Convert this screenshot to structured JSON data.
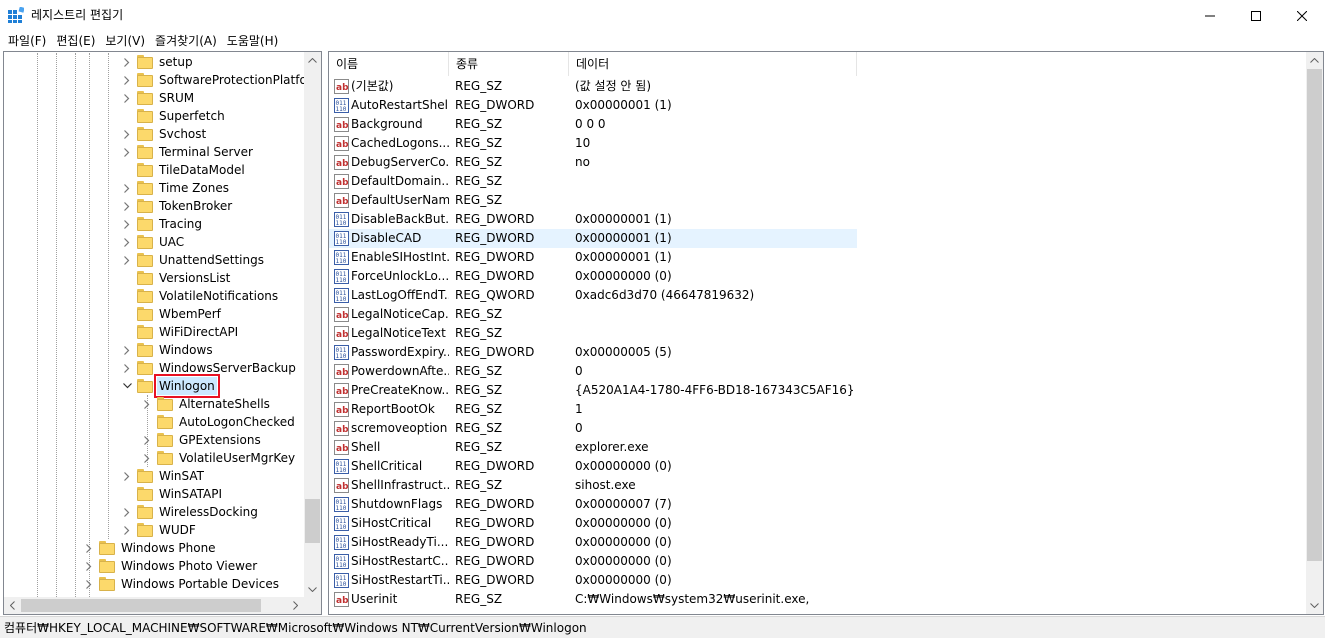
{
  "window": {
    "title": "레지스트리 편집기",
    "app_icon": "regedit-icon"
  },
  "menu": [
    {
      "label": "파일(F)"
    },
    {
      "label": "편집(E)"
    },
    {
      "label": "보기(V)"
    },
    {
      "label": "즐겨찾기(A)"
    },
    {
      "label": "도움말(H)"
    }
  ],
  "tree": {
    "items": [
      {
        "label": "setup",
        "expandable": true,
        "level": 1
      },
      {
        "label": "SoftwareProtectionPlatform",
        "expandable": true,
        "level": 1
      },
      {
        "label": "SRUM",
        "expandable": true,
        "level": 1
      },
      {
        "label": "Superfetch",
        "expandable": false,
        "level": 1
      },
      {
        "label": "Svchost",
        "expandable": true,
        "level": 1
      },
      {
        "label": "Terminal Server",
        "expandable": true,
        "level": 1
      },
      {
        "label": "TileDataModel",
        "expandable": false,
        "level": 1
      },
      {
        "label": "Time Zones",
        "expandable": true,
        "level": 1
      },
      {
        "label": "TokenBroker",
        "expandable": true,
        "level": 1
      },
      {
        "label": "Tracing",
        "expandable": true,
        "level": 1
      },
      {
        "label": "UAC",
        "expandable": true,
        "level": 1
      },
      {
        "label": "UnattendSettings",
        "expandable": true,
        "level": 1
      },
      {
        "label": "VersionsList",
        "expandable": false,
        "level": 1
      },
      {
        "label": "VolatileNotifications",
        "expandable": false,
        "level": 1
      },
      {
        "label": "WbemPerf",
        "expandable": false,
        "level": 1
      },
      {
        "label": "WiFiDirectAPI",
        "expandable": false,
        "level": 1
      },
      {
        "label": "Windows",
        "expandable": true,
        "level": 1
      },
      {
        "label": "WindowsServerBackup",
        "expandable": true,
        "level": 1
      },
      {
        "label": "Winlogon",
        "expandable": true,
        "expanded": true,
        "selected": true,
        "level": 1
      },
      {
        "label": "AlternateShells",
        "expandable": true,
        "level": 2
      },
      {
        "label": "AutoLogonChecked",
        "expandable": false,
        "level": 2
      },
      {
        "label": "GPExtensions",
        "expandable": true,
        "level": 2
      },
      {
        "label": "VolatileUserMgrKey",
        "expandable": true,
        "level": 2
      },
      {
        "label": "WinSAT",
        "expandable": true,
        "level": 1
      },
      {
        "label": "WinSATAPI",
        "expandable": false,
        "level": 1
      },
      {
        "label": "WirelessDocking",
        "expandable": true,
        "level": 1
      },
      {
        "label": "WUDF",
        "expandable": true,
        "level": 1
      },
      {
        "label": "Windows Phone",
        "expandable": true,
        "level": 0
      },
      {
        "label": "Windows Photo Viewer",
        "expandable": true,
        "level": 0
      },
      {
        "label": "Windows Portable Devices",
        "expandable": true,
        "level": 0
      }
    ]
  },
  "list": {
    "columns": [
      "이름",
      "종류",
      "데이터"
    ],
    "rows": [
      {
        "icon": "string-value-icon",
        "name": "(기본값)",
        "type": "REG_SZ",
        "data": "(값 설정 안 됨)"
      },
      {
        "icon": "binary-value-icon",
        "name": "AutoRestartShell",
        "type": "REG_DWORD",
        "data": "0x00000001 (1)"
      },
      {
        "icon": "string-value-icon",
        "name": "Background",
        "type": "REG_SZ",
        "data": "0 0 0"
      },
      {
        "icon": "string-value-icon",
        "name": "CachedLogons...",
        "type": "REG_SZ",
        "data": "10"
      },
      {
        "icon": "string-value-icon",
        "name": "DebugServerCo...",
        "type": "REG_SZ",
        "data": "no"
      },
      {
        "icon": "string-value-icon",
        "name": "DefaultDomain...",
        "type": "REG_SZ",
        "data": ""
      },
      {
        "icon": "string-value-icon",
        "name": "DefaultUserName",
        "type": "REG_SZ",
        "data": ""
      },
      {
        "icon": "binary-value-icon",
        "name": "DisableBackBut...",
        "type": "REG_DWORD",
        "data": "0x00000001 (1)"
      },
      {
        "icon": "binary-value-icon",
        "name": "DisableCAD",
        "type": "REG_DWORD",
        "data": "0x00000001 (1)",
        "highlight": true
      },
      {
        "icon": "binary-value-icon",
        "name": "EnableSIHostInt...",
        "type": "REG_DWORD",
        "data": "0x00000001 (1)"
      },
      {
        "icon": "binary-value-icon",
        "name": "ForceUnlockLo...",
        "type": "REG_DWORD",
        "data": "0x00000000 (0)"
      },
      {
        "icon": "binary-value-icon",
        "name": "LastLogOffEndT...",
        "type": "REG_QWORD",
        "data": "0xadc6d3d70 (46647819632)"
      },
      {
        "icon": "string-value-icon",
        "name": "LegalNoticeCap...",
        "type": "REG_SZ",
        "data": ""
      },
      {
        "icon": "string-value-icon",
        "name": "LegalNoticeText",
        "type": "REG_SZ",
        "data": ""
      },
      {
        "icon": "binary-value-icon",
        "name": "PasswordExpiry...",
        "type": "REG_DWORD",
        "data": "0x00000005 (5)"
      },
      {
        "icon": "string-value-icon",
        "name": "PowerdownAfte...",
        "type": "REG_SZ",
        "data": "0"
      },
      {
        "icon": "string-value-icon",
        "name": "PreCreateKnow...",
        "type": "REG_SZ",
        "data": "{A520A1A4-1780-4FF6-BD18-167343C5AF16}"
      },
      {
        "icon": "string-value-icon",
        "name": "ReportBootOk",
        "type": "REG_SZ",
        "data": "1"
      },
      {
        "icon": "string-value-icon",
        "name": "scremoveoption",
        "type": "REG_SZ",
        "data": "0"
      },
      {
        "icon": "string-value-icon",
        "name": "Shell",
        "type": "REG_SZ",
        "data": "explorer.exe"
      },
      {
        "icon": "binary-value-icon",
        "name": "ShellCritical",
        "type": "REG_DWORD",
        "data": "0x00000000 (0)"
      },
      {
        "icon": "string-value-icon",
        "name": "ShellInfrastruct...",
        "type": "REG_SZ",
        "data": "sihost.exe"
      },
      {
        "icon": "binary-value-icon",
        "name": "ShutdownFlags",
        "type": "REG_DWORD",
        "data": "0x00000007 (7)"
      },
      {
        "icon": "binary-value-icon",
        "name": "SiHostCritical",
        "type": "REG_DWORD",
        "data": "0x00000000 (0)"
      },
      {
        "icon": "binary-value-icon",
        "name": "SiHostReadyTi...",
        "type": "REG_DWORD",
        "data": "0x00000000 (0)"
      },
      {
        "icon": "binary-value-icon",
        "name": "SiHostRestartC...",
        "type": "REG_DWORD",
        "data": "0x00000000 (0)"
      },
      {
        "icon": "binary-value-icon",
        "name": "SiHostRestartTi...",
        "type": "REG_DWORD",
        "data": "0x00000000 (0)"
      },
      {
        "icon": "string-value-icon",
        "name": "Userinit",
        "type": "REG_SZ",
        "data": "C:₩Windows₩system32₩userinit.exe,"
      }
    ]
  },
  "status": {
    "path": "컴퓨터₩HKEY_LOCAL_MACHINE₩SOFTWARE₩Microsoft₩Windows NT₩CurrentVersion₩Winlogon"
  },
  "colors": {
    "highlight_row": "#e5f3ff",
    "selection_outline": "#e81123",
    "folder": "#fcd96b"
  }
}
